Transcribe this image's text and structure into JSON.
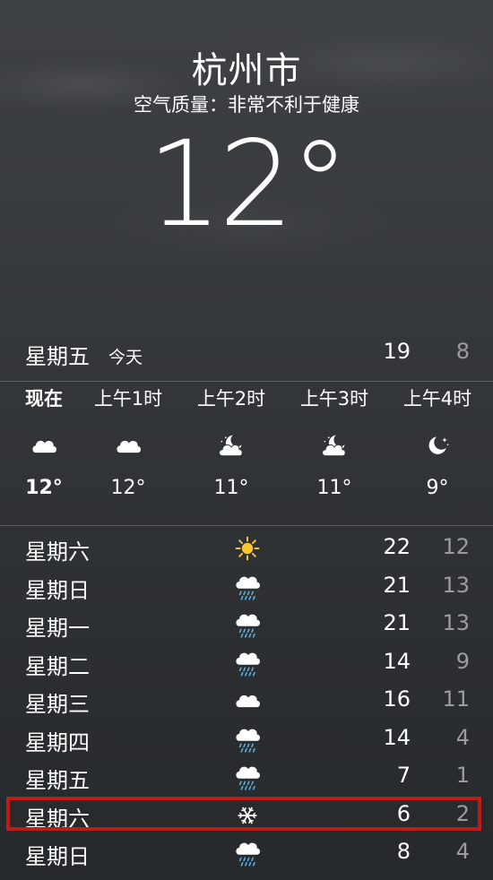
{
  "header": {
    "city": "杭州市",
    "air_quality": "空气质量：非常不利于健康",
    "current_temp": "12°"
  },
  "today": {
    "day": "星期五",
    "label": "今天",
    "high": "19",
    "low": "8"
  },
  "hourly": [
    {
      "time": "现在",
      "icon": "cloud-icon",
      "temp": "12°"
    },
    {
      "time": "上午1时",
      "icon": "cloud-icon",
      "temp": "12°"
    },
    {
      "time": "上午2时",
      "icon": "moon-cloud-icon",
      "temp": "11°"
    },
    {
      "time": "上午3时",
      "icon": "moon-cloud-icon",
      "temp": "11°"
    },
    {
      "time": "上午4时",
      "icon": "moon-stars-icon",
      "temp": "9°"
    }
  ],
  "daily": [
    {
      "day": "星期六",
      "icon": "sun-icon",
      "high": "22",
      "low": "12"
    },
    {
      "day": "星期日",
      "icon": "rain-icon",
      "high": "21",
      "low": "13"
    },
    {
      "day": "星期一",
      "icon": "rain-icon",
      "high": "21",
      "low": "13"
    },
    {
      "day": "星期二",
      "icon": "rain-icon",
      "high": "14",
      "low": "9"
    },
    {
      "day": "星期三",
      "icon": "cloud-icon",
      "high": "16",
      "low": "11"
    },
    {
      "day": "星期四",
      "icon": "rain-icon",
      "high": "14",
      "low": "4"
    },
    {
      "day": "星期五",
      "icon": "rain-icon",
      "high": "7",
      "low": "1"
    },
    {
      "day": "星期六",
      "icon": "snowflake-icon",
      "high": "6",
      "low": "2"
    },
    {
      "day": "星期日",
      "icon": "rain-icon",
      "high": "8",
      "low": "4"
    }
  ],
  "colors": {
    "highlight": "#c21a14",
    "low_temp": "#9a9c9e",
    "sun": "#f7c531",
    "rain": "#5aaee0"
  }
}
